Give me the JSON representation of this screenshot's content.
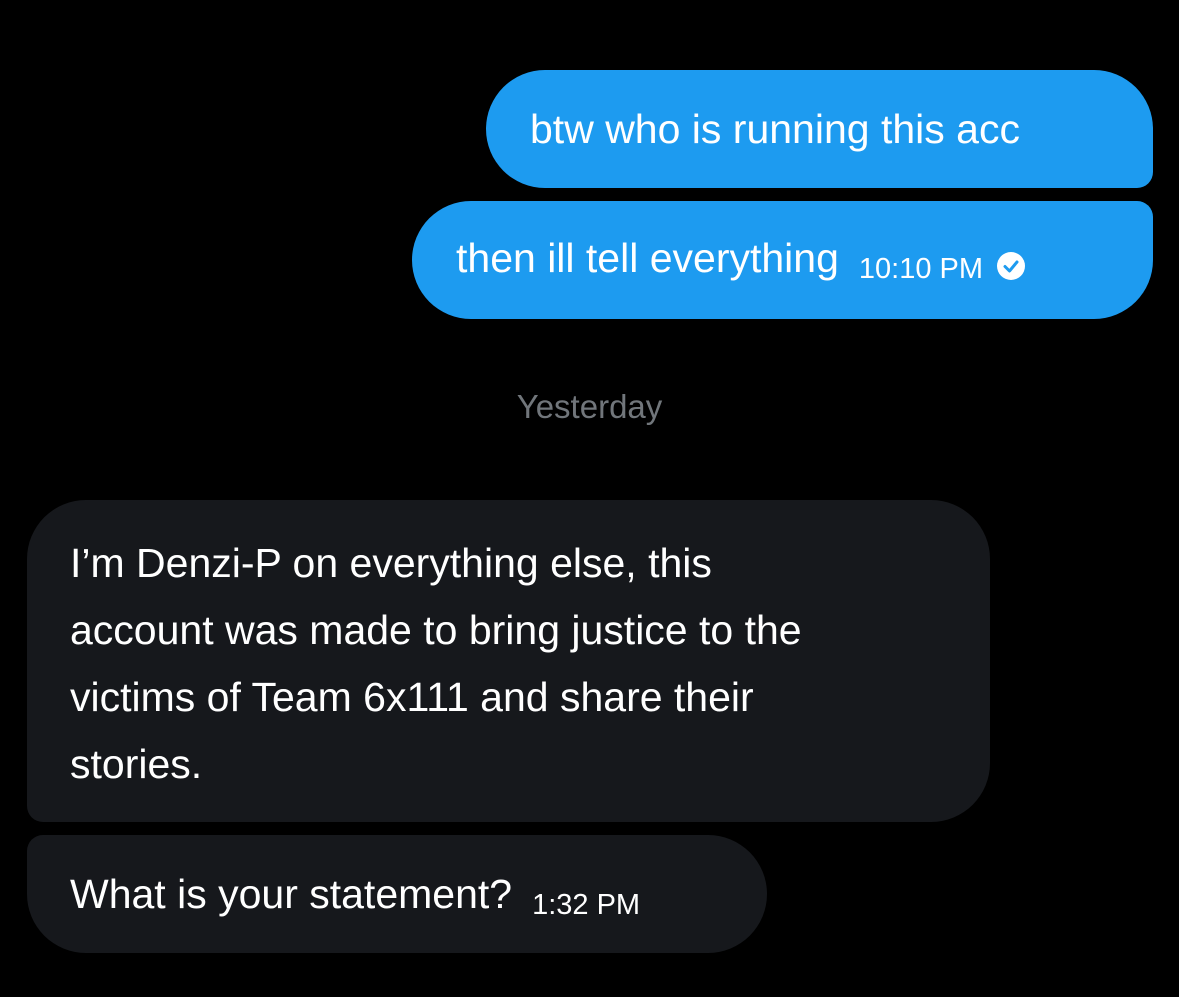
{
  "conversation": {
    "messages": [
      {
        "direction": "sent",
        "text": "btw who is running this acc"
      },
      {
        "direction": "sent",
        "text": "then ill tell everything",
        "time": "10:10 PM",
        "status_icon": "read-check-icon"
      },
      {
        "direction": "received",
        "lines": [
          "I’m Denzi-P on everything else, this",
          "account was made to bring justice to the",
          "victims of Team 6x111 and share their",
          "stories."
        ]
      },
      {
        "direction": "received",
        "text": "What is your statement?",
        "time": "1:32 PM"
      }
    ],
    "day_separator": "Yesterday"
  },
  "colors": {
    "background": "#000000",
    "sent_bubble": "#1d9bf0",
    "received_bubble": "#16181c",
    "separator_text": "#71767b"
  }
}
